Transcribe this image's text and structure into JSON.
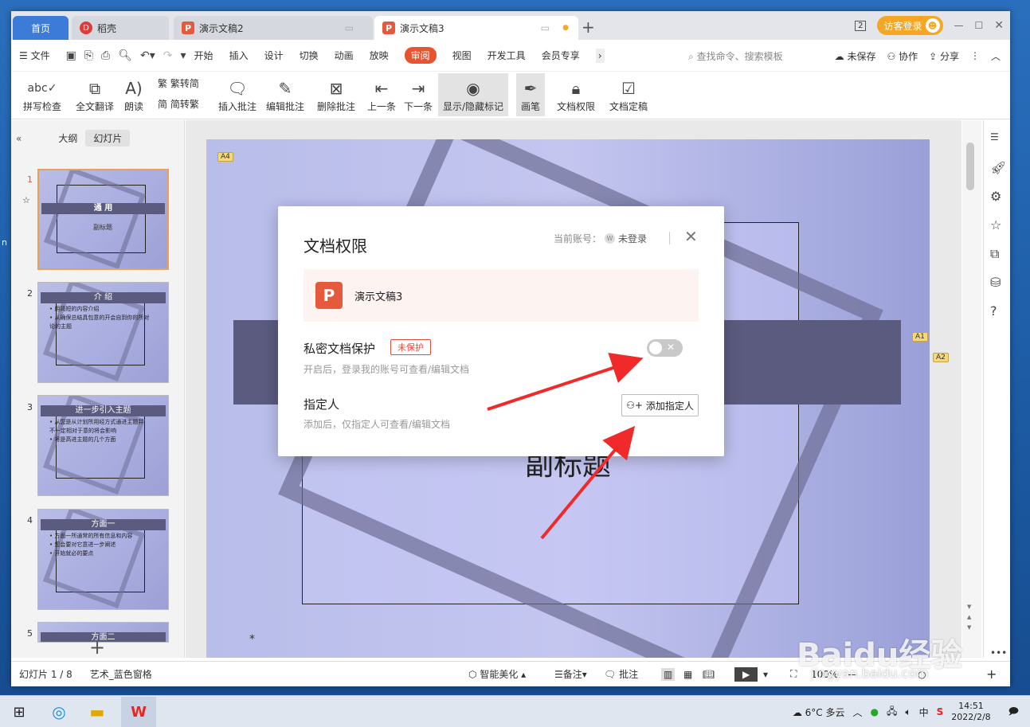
{
  "tabs": {
    "home": "首页",
    "daoke": "稻壳",
    "doc2": "演示文稿2",
    "doc3": "演示文稿3",
    "login": "访客登录",
    "badge": "2"
  },
  "menu": {
    "file": "文件",
    "items": [
      "开始",
      "插入",
      "设计",
      "切换",
      "动画",
      "放映",
      "审阅",
      "视图",
      "开发工具",
      "会员专享"
    ],
    "search": "查找命令、搜索模板",
    "unsaved": "未保存",
    "collab": "协作",
    "share": "分享"
  },
  "ribbon": {
    "spell": "拼写检查",
    "translate": "全文翻译",
    "read": "朗读",
    "trad2simp": "繁转简",
    "simp2trad": "简转繁",
    "insert_comment": "插入批注",
    "edit_comment": "编辑批注",
    "delete_comment": "删除批注",
    "prev": "上一条",
    "next": "下一条",
    "show_hide": "显示/隐藏标记",
    "pen": "画笔",
    "doc_perm": "文档权限",
    "doc_final": "文档定稿"
  },
  "sidepanel": {
    "outline": "大纲",
    "slides": "幻灯片",
    "thumbs": [
      {
        "num": "1",
        "title": "通 用",
        "sub": "副标题"
      },
      {
        "num": "2",
        "title": "介 绍",
        "lines": [
          "• 用简短的内容介绍",
          "• 从确保总结具包意的开会自到你的所对",
          "  论的主题"
        ]
      },
      {
        "num": "3",
        "title": "进一步引入主题",
        "lines": [
          "• 从您是从计划所用经方式通进主题并",
          "  不一定相对于意的将会影响",
          "• 将是高进主题的几个方面"
        ]
      },
      {
        "num": "4",
        "title": "方面一",
        "lines": [
          "• 方面一所通常的所有信息和内容",
          "• 您会要对它意进一步阐述",
          "• 开始就必的要点"
        ]
      },
      {
        "num": "5",
        "title": "方面二"
      }
    ]
  },
  "slide": {
    "subtitle": "副标题",
    "comments": [
      "A4",
      "A1",
      "A2"
    ]
  },
  "dialog": {
    "title": "文档权限",
    "account_label": "当前账号：",
    "account_value": "未登录",
    "file_name": "演示文稿3",
    "private_label": "私密文档保护",
    "private_status": "未保护",
    "private_desc": "开启后，登录我的账号可查看/编辑文档",
    "toggle_on": false,
    "assignee_label": "指定人",
    "assignee_desc": "添加后，仅指定人可查看/编辑文档",
    "add_button": "添加指定人"
  },
  "status": {
    "slide_pos": "幻灯片 1 / 8",
    "theme": "艺术_蓝色窗格",
    "beautify": "智能美化",
    "notes": "备注",
    "comment": "批注",
    "zoom": "100%"
  },
  "taskbar": {
    "weather": "6°C 多云",
    "ime": "中",
    "time": "14:51",
    "date": "2022/2/8"
  },
  "watermark": {
    "brand": "Baidu经验",
    "url": "jingyan.baidu.com"
  },
  "colors": {
    "accent": "#e8542f",
    "ppt": "#e55a3c",
    "home_tab": "#3d7bd9",
    "slide_bar": "#5b5b80"
  }
}
